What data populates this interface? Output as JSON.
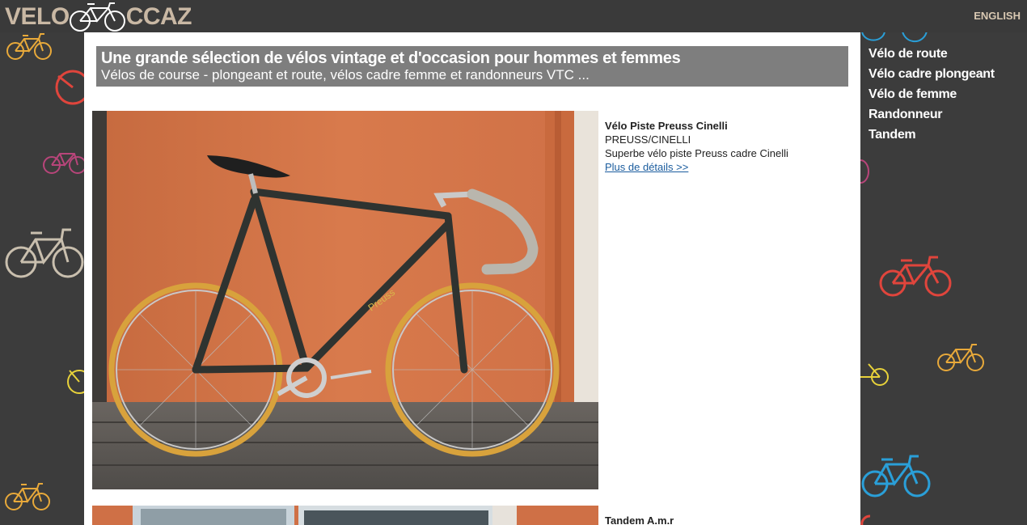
{
  "header": {
    "logo_left": "VELO",
    "logo_right": "CCAZ",
    "language_link": "ENGLISH"
  },
  "banner": {
    "title": "Une grande sélection de vélos vintage et d'occasion pour hommes et femmes",
    "subtitle": "Vélos de course - plongeant et route, vélos cadre femme et randonneurs VTC ..."
  },
  "listings": [
    {
      "title": "Vélo Piste Preuss Cinelli",
      "brand": "PREUSS/CINELLI",
      "description": "Superbe vélo piste Preuss cadre Cinelli",
      "details_link": "Plus de détails >>"
    },
    {
      "title": "Tandem A.m.r"
    }
  ],
  "sidebar": {
    "items": [
      {
        "label": "Vélo de route"
      },
      {
        "label": "Vélo cadre plongeant"
      },
      {
        "label": "Vélo de femme"
      },
      {
        "label": "Randonneur"
      },
      {
        "label": "Tandem"
      }
    ]
  },
  "colors": {
    "background": "#3c3c3c",
    "logo": "#c9b8a4",
    "banner": "#7e7e7e",
    "link": "#1a5c9e"
  }
}
